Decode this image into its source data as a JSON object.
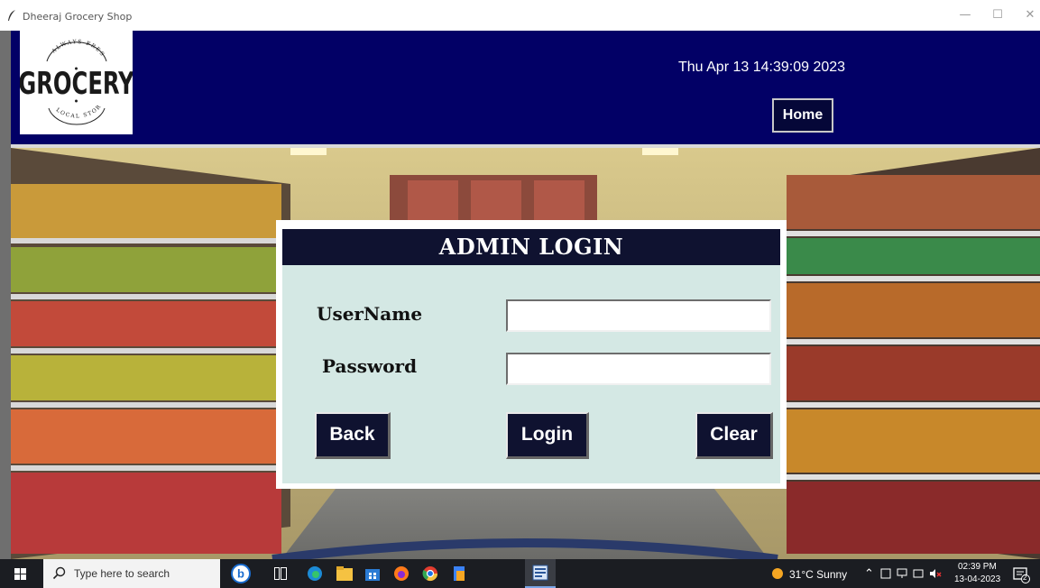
{
  "window": {
    "title": "Dheeraj Grocery Shop",
    "minimize_glyph": "—",
    "maximize_glyph": "☐",
    "close_glyph": "✕"
  },
  "header": {
    "logo": {
      "word": "GROCERY",
      "top_text": "ALWAYS FRESH",
      "bottom_text": "LOCAL STORE"
    },
    "datetime": "Thu Apr 13 14:39:09 2023",
    "home_label": "Home"
  },
  "login": {
    "heading": "ADMIN LOGIN",
    "username_label": "UserName",
    "password_label": "Password",
    "username_value": "",
    "password_value": "",
    "back_label": "Back",
    "login_label": "Login",
    "clear_label": "Clear"
  },
  "taskbar": {
    "search_placeholder": "Type here to search",
    "weather": "31°C  Sunny",
    "time": "02:39 PM",
    "date": "13-04-2023",
    "notification_count": "2",
    "icons": [
      "windows-start-icon",
      "bing-icon",
      "task-view-icon",
      "edge-icon",
      "file-explorer-icon",
      "store-icon",
      "firefox-icon",
      "chrome-icon",
      "app-icon",
      "word-icon"
    ]
  },
  "colors": {
    "header_bg": "#020066",
    "panel_bg": "#d4e8e4",
    "button_bg": "#0f1230",
    "taskbar_bg": "#1b1d22"
  }
}
